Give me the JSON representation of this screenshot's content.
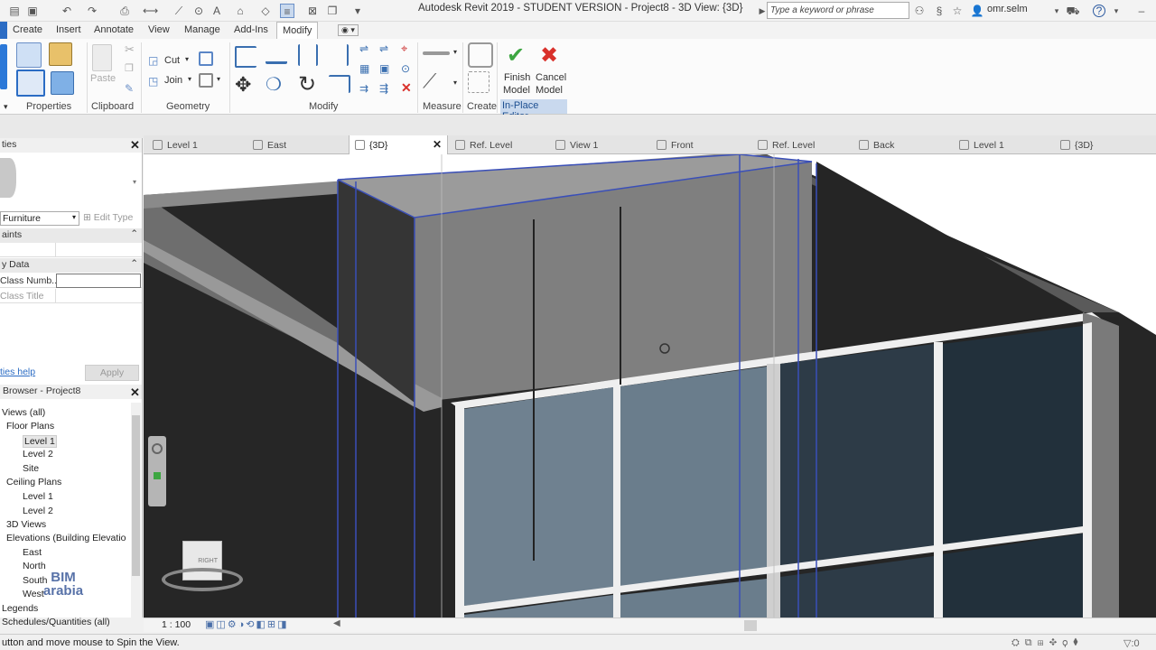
{
  "app": {
    "title": "Autodesk Revit 2019 - STUDENT VERSION - Project8 - 3D View: {3D}",
    "search_placeholder": "Type a keyword or phrase",
    "user": "omr.selm"
  },
  "ribbon_tabs": [
    "Create",
    "Insert",
    "Annotate",
    "View",
    "Manage",
    "Add-Ins",
    "Modify"
  ],
  "ribbon": {
    "panels": [
      "Properties",
      "Clipboard",
      "Geometry",
      "Modify",
      "Measure",
      "Create",
      "In-Place Editor"
    ],
    "paste_label": "Paste",
    "cut_label": "Cut",
    "join_label": "Join",
    "finish_label_1": "Finish",
    "finish_label_2": "Model",
    "cancel_label_1": "Cancel",
    "cancel_label_2": "Model",
    "colors": {
      "finish": "#3da641",
      "cancel": "#d9312b",
      "accent": "#1d4f91"
    }
  },
  "properties": {
    "title": "ties",
    "type_selector": "Furniture",
    "edit_type": "Edit Type",
    "group_constraints": "aints",
    "group_identity": "y Data",
    "field_class_number": "Class Numb...",
    "field_class_title": "Class Title",
    "help": "ties help",
    "apply": "Apply"
  },
  "browser": {
    "title": "Browser - Project8",
    "items": [
      {
        "label": "Views (all)",
        "level": 0
      },
      {
        "label": "Floor Plans",
        "level": 1
      },
      {
        "label": "Level 1",
        "level": 2,
        "selected": true
      },
      {
        "label": "Level 2",
        "level": 2
      },
      {
        "label": "Site",
        "level": 2
      },
      {
        "label": "Ceiling Plans",
        "level": 1
      },
      {
        "label": "Level 1",
        "level": 2
      },
      {
        "label": "Level 2",
        "level": 2
      },
      {
        "label": "3D Views",
        "level": 1
      },
      {
        "label": "Elevations (Building Elevatio",
        "level": 1
      },
      {
        "label": "East",
        "level": 2
      },
      {
        "label": "North",
        "level": 2
      },
      {
        "label": "South",
        "level": 2
      },
      {
        "label": "West",
        "level": 2
      },
      {
        "label": "Legends",
        "level": 0
      },
      {
        "label": "Schedules/Quantities (all)",
        "level": 0
      }
    ]
  },
  "view_tabs": [
    {
      "label": "Level 1",
      "active": false
    },
    {
      "label": "East",
      "active": false
    },
    {
      "label": "{3D}",
      "active": true
    },
    {
      "label": "Ref. Level",
      "active": false
    },
    {
      "label": "View 1",
      "active": false
    },
    {
      "label": "Front",
      "active": false
    },
    {
      "label": "Ref. Level",
      "active": false
    },
    {
      "label": "Back",
      "active": false
    },
    {
      "label": "Level 1",
      "active": false
    },
    {
      "label": "{3D}",
      "active": false
    }
  ],
  "viewport": {
    "viewcube_face": "RIGHT",
    "watermark_1": "BIM",
    "watermark_2": "arabia"
  },
  "view_control": {
    "scale": "1 : 100"
  },
  "status": {
    "text": "utton and move mouse to Spin the View."
  }
}
